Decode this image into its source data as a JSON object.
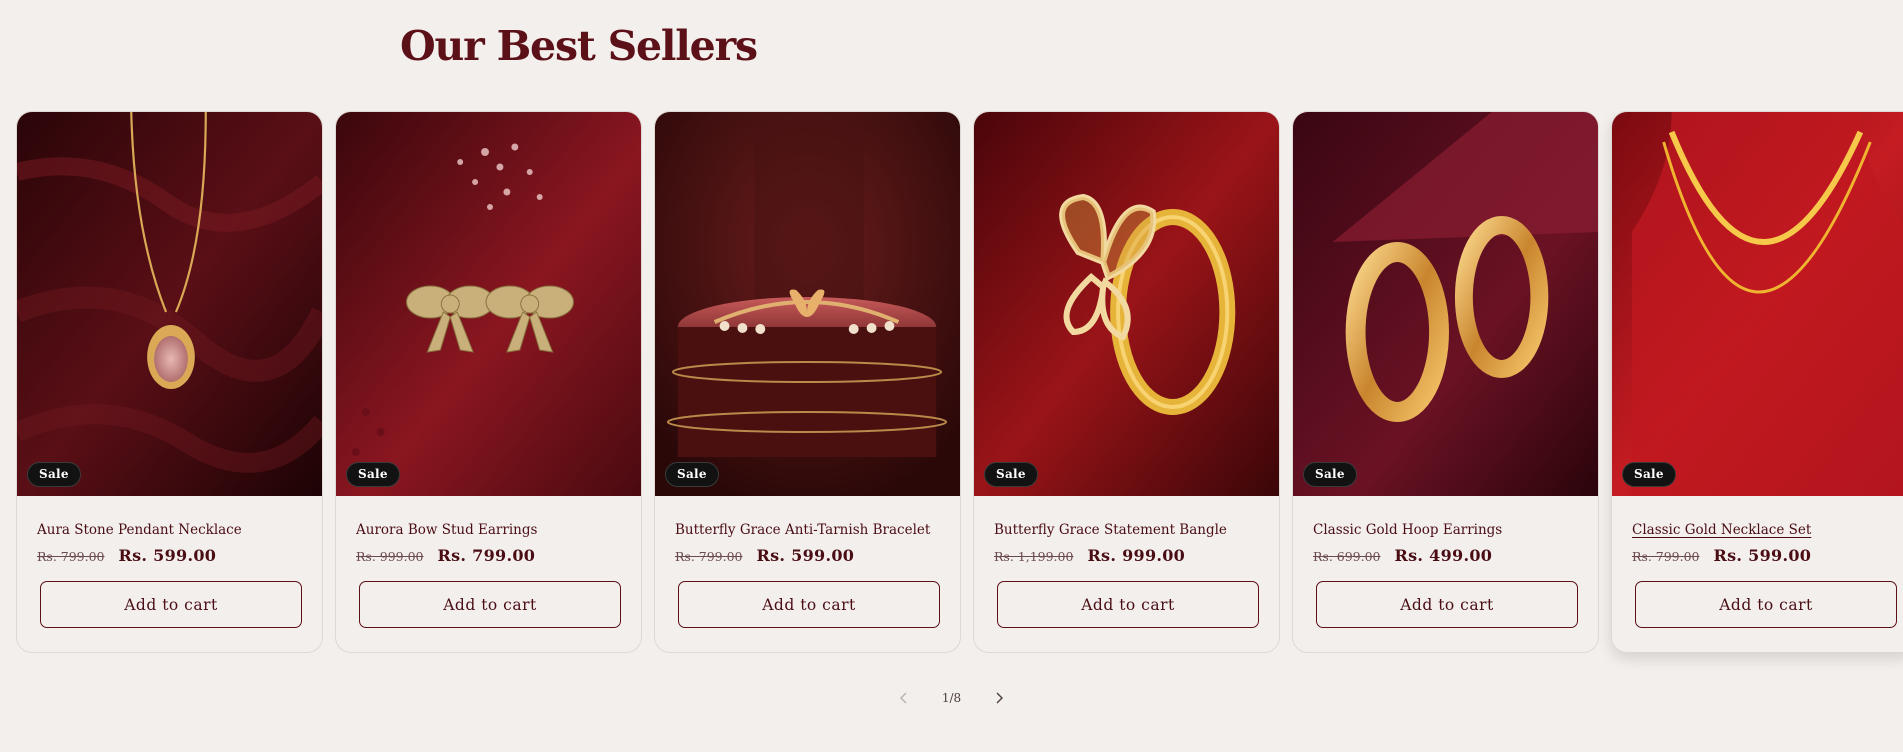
{
  "section": {
    "title": "Our Best Sellers"
  },
  "products": [
    {
      "title": "Aura Stone Pendant Necklace",
      "compare_price": "Rs. 799.00",
      "price": "Rs. 599.00",
      "badge": "Sale",
      "button": "Add to cart"
    },
    {
      "title": "Aurora Bow Stud Earrings",
      "compare_price": "Rs. 999.00",
      "price": "Rs. 799.00",
      "badge": "Sale",
      "button": "Add to cart"
    },
    {
      "title": "Butterfly Grace Anti-Tarnish Bracelet",
      "compare_price": "Rs. 799.00",
      "price": "Rs. 599.00",
      "badge": "Sale",
      "button": "Add to cart"
    },
    {
      "title": "Butterfly Grace Statement Bangle",
      "compare_price": "Rs. 1,199.00",
      "price": "Rs. 999.00",
      "badge": "Sale",
      "button": "Add to cart"
    },
    {
      "title": "Classic Gold Hoop Earrings",
      "compare_price": "Rs. 699.00",
      "price": "Rs. 499.00",
      "badge": "Sale",
      "button": "Add to cart"
    },
    {
      "title": "Classic Gold Necklace Set",
      "compare_price": "Rs. 799.00",
      "price": "Rs. 599.00",
      "badge": "Sale",
      "button": "Add to cart"
    }
  ],
  "pagination": {
    "counter": "1/8",
    "prev_icon": "chevron-left-icon",
    "next_icon": "chevron-right-icon"
  },
  "colors": {
    "background": "#f3efec",
    "brand": "#5c1018",
    "badge": "#121212"
  }
}
